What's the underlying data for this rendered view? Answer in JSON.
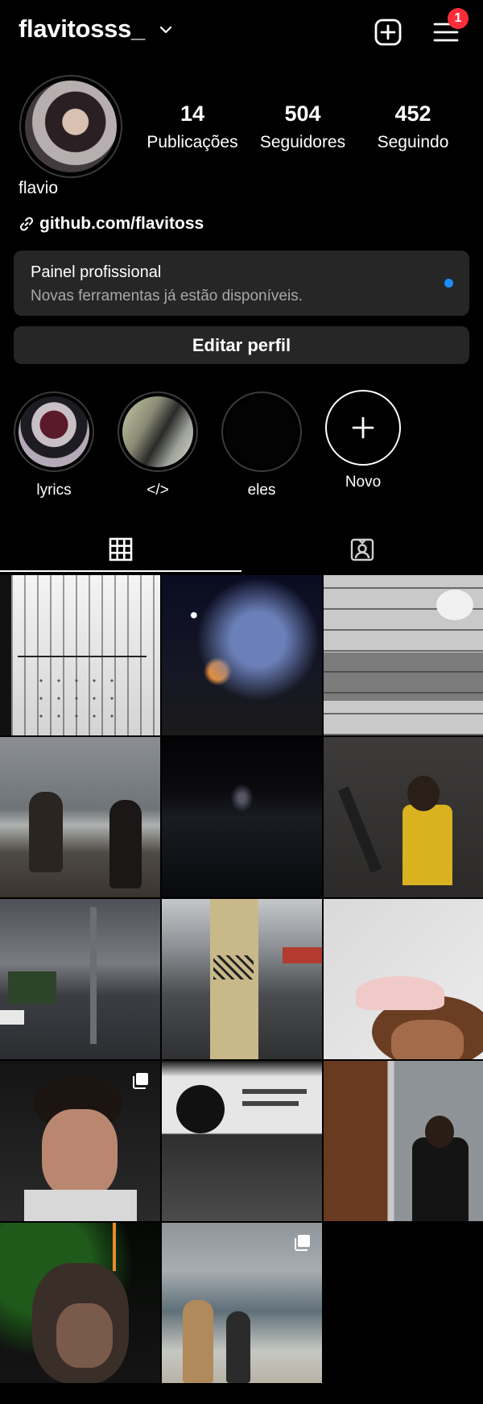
{
  "header": {
    "username": "flavitosss_",
    "notification_count": "1"
  },
  "profile": {
    "stats": [
      {
        "value": "14",
        "label": "Publicações"
      },
      {
        "value": "504",
        "label": "Seguidores"
      },
      {
        "value": "452",
        "label": "Seguindo"
      }
    ],
    "display_name": "flavio",
    "link": "github.com/flavitoss"
  },
  "pro_panel": {
    "title": "Painel profissional",
    "subtitle": "Novas ferramentas já estão disponíveis."
  },
  "edit_button": "Editar perfil",
  "highlights": [
    {
      "label": "lyrics"
    },
    {
      "label": "</>"
    },
    {
      "label": "eles"
    }
  ],
  "new_highlight": "Novo",
  "tabs": [
    {
      "icon": "grid-icon",
      "active": true
    },
    {
      "icon": "tagged-icon",
      "active": false
    }
  ],
  "colors": {
    "background": "#000000",
    "panel": "#262626",
    "badge": "#ff2d3a",
    "dot": "#1a8cff"
  },
  "posts": [
    {
      "kind": "manga panel",
      "multi": false
    },
    {
      "kind": "night lights",
      "multi": false
    },
    {
      "kind": "manga classroom",
      "multi": false
    },
    {
      "kind": "beach couple",
      "multi": false
    },
    {
      "kind": "night sea",
      "multi": false
    },
    {
      "kind": "mirror selfie chainsaw",
      "multi": false
    },
    {
      "kind": "street",
      "multi": false
    },
    {
      "kind": "graffiti wall",
      "multi": false
    },
    {
      "kind": "pink cap selfie",
      "multi": false
    },
    {
      "kind": "portrait",
      "multi": true
    },
    {
      "kind": "book page",
      "multi": false
    },
    {
      "kind": "mirror selfie",
      "multi": false
    },
    {
      "kind": "night hug",
      "multi": false
    },
    {
      "kind": "beach couple 2",
      "multi": true
    }
  ]
}
